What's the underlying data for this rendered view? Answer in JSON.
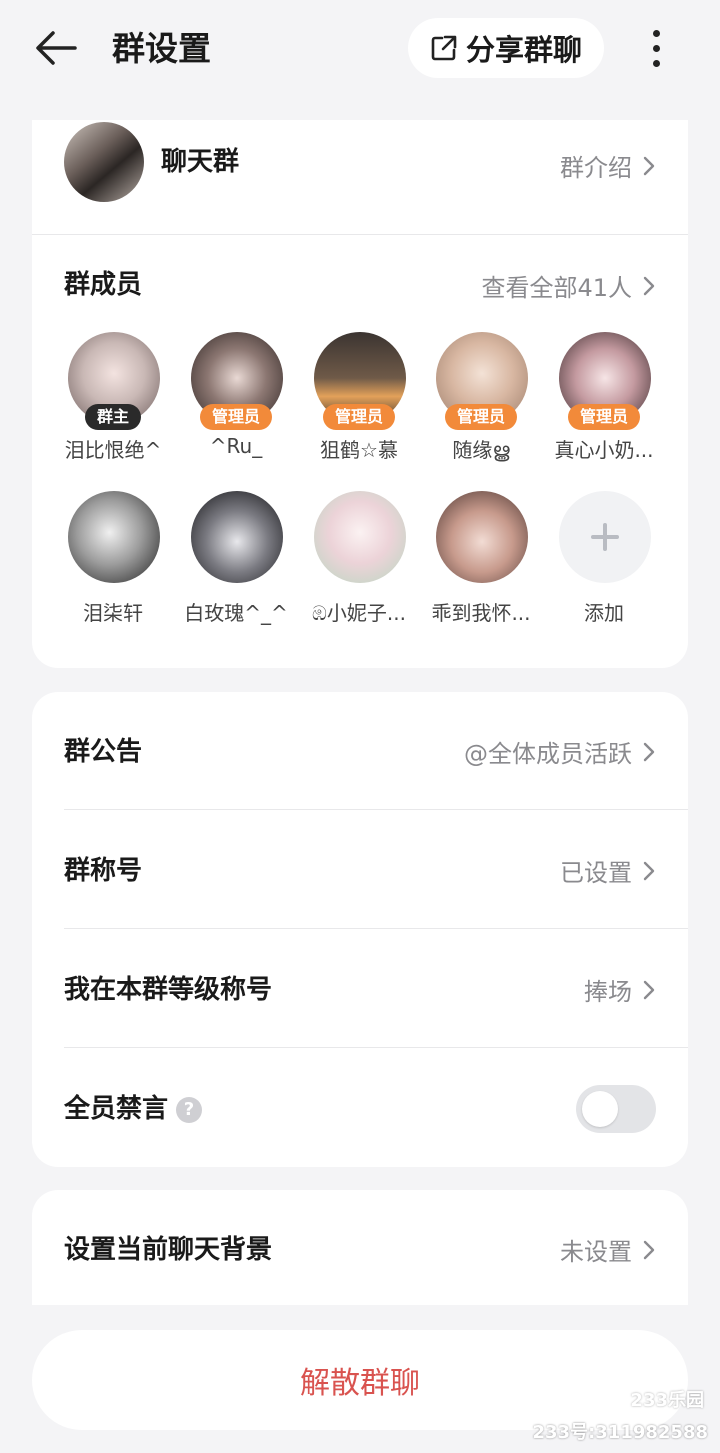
{
  "header": {
    "title": "群设置",
    "share_label": "分享群聊"
  },
  "group": {
    "name": "聊天群",
    "intro_label": "群介绍"
  },
  "members": {
    "title": "群成员",
    "view_all": "查看全部41人",
    "list": [
      {
        "name": "泪比恨绝^",
        "badge": "群主",
        "role": "owner"
      },
      {
        "name": "^Ru_",
        "badge": "管理员",
        "role": "admin"
      },
      {
        "name": "狙鹤☆慕",
        "badge": "管理员",
        "role": "admin"
      },
      {
        "name": "随缘ൠ",
        "badge": "管理员",
        "role": "admin"
      },
      {
        "name": "真心小奶...",
        "badge": "管理员",
        "role": "admin"
      },
      {
        "name": "泪柒轩",
        "badge": "",
        "role": "member"
      },
      {
        "name": "白玫瑰^_^",
        "badge": "",
        "role": "member"
      },
      {
        "name": "ඹ小妮子...",
        "badge": "",
        "role": "member"
      },
      {
        "name": "乖到我怀...",
        "badge": "",
        "role": "member"
      }
    ],
    "add_label": "添加"
  },
  "settings": {
    "announcement": {
      "label": "群公告",
      "value": "@全体成员活跃"
    },
    "nickname": {
      "label": "群称号",
      "value": "已设置"
    },
    "level_title": {
      "label": "我在本群等级称号",
      "value": "捧场"
    },
    "mute_all": {
      "label": "全员禁言",
      "help": "?",
      "enabled": false
    },
    "background": {
      "label": "设置当前聊天背景",
      "value": "未设置"
    }
  },
  "disband_label": "解散群聊",
  "watermark": {
    "logo": "233乐园",
    "id": "233号:311982588"
  },
  "colors": {
    "admin_badge": "#f28a3a",
    "owner_badge": "#2a2a2a",
    "danger": "#d9534f"
  }
}
